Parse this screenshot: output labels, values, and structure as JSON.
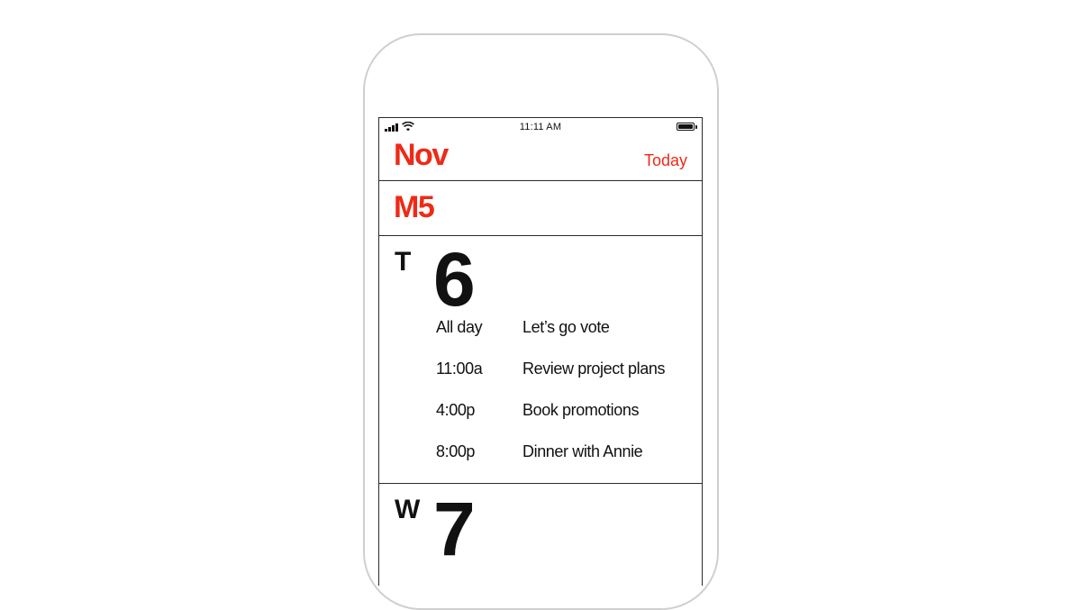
{
  "status_bar": {
    "time": "11:11 AM"
  },
  "header": {
    "month": "Nov",
    "today_label": "Today"
  },
  "days": [
    {
      "weekday": "M",
      "day": "5",
      "collapsed": true
    },
    {
      "weekday": "T",
      "day": "6",
      "collapsed": false,
      "events": [
        {
          "time": "All day",
          "title": "Let’s go vote"
        },
        {
          "time": "11:00a",
          "title": "Review project plans"
        },
        {
          "time": "4:00p",
          "title": "Book promotions"
        },
        {
          "time": "8:00p",
          "title": "Dinner with Annie"
        }
      ]
    },
    {
      "weekday": "W",
      "day": "7",
      "collapsed": false,
      "events": []
    }
  ],
  "colors": {
    "accent": "#ee2a17",
    "text": "#111111",
    "divider": "#2a2a2a",
    "phone_frame": "#cfcfcf"
  },
  "icons": {
    "signal": "cellular-signal-icon",
    "wifi": "wifi-icon",
    "battery": "battery-icon"
  }
}
